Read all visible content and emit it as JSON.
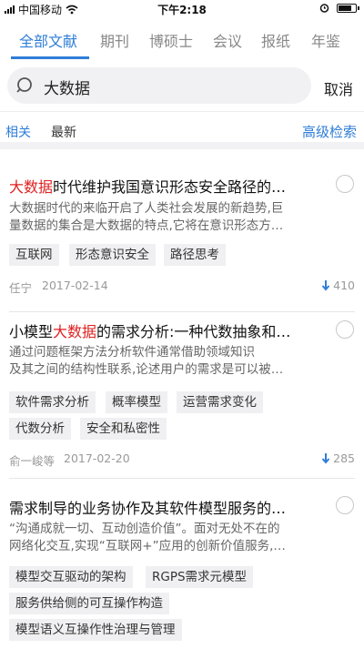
{
  "status_bar": {
    "carrier": "中国移动",
    "time": "下午2:18"
  },
  "tabs": [
    "全部文献",
    "期刊",
    "博硕士",
    "会议",
    "报纸",
    "年鉴"
  ],
  "search": {
    "query": "大数据",
    "cancel_label": "取消"
  },
  "sort": {
    "relevance": "相关",
    "newest": "最新",
    "advanced": "高级检索"
  },
  "results": [
    {
      "title_highlight": "大数据",
      "title_rest": "时代维护我国意识形态安全路径的…",
      "snippet_lines": [
        "大数据时代的来临开启了人类社会发展的新趋势,巨",
        "量数据的集合是大数据的特点,它将在意识形态方…"
      ],
      "tags": [
        "互联网",
        "形态意识安全",
        "路径思考"
      ],
      "author": "任宁",
      "date": "2017-02-14",
      "downloads": "410"
    },
    {
      "title_prefix": "小模型",
      "title_highlight": "大数据",
      "title_rest": "的需求分析:一种代数抽象和…",
      "snippet_lines": [
        "通过问题框架方法分析软件通常借助领域知识",
        "及其之间的结构性联系,论述用户的需求是可以被…"
      ],
      "tags": [
        "软件需求分析",
        "概率模型",
        "运营需求变化",
        "代数分析",
        "安全和私密性"
      ],
      "author": "俞一峻等",
      "date": "2017-02-20",
      "downloads": "285"
    },
    {
      "title_rest": "需求制导的业务协作及其软件模型服务的…",
      "snippet_lines": [
        "“沟通成就一切、互动创造价值”。面对无处不在的",
        "网络化交互,实现“互联网+”应用的创新价值服务,…"
      ],
      "tags": [
        "模型交互驱动的架构",
        "RGPS需求元模型",
        "服务供给侧的可互操作构造",
        "模型语义互操作性治理与管理"
      ]
    }
  ],
  "colors": {
    "accent": "#2f7ed8",
    "highlight": "#e02020"
  }
}
